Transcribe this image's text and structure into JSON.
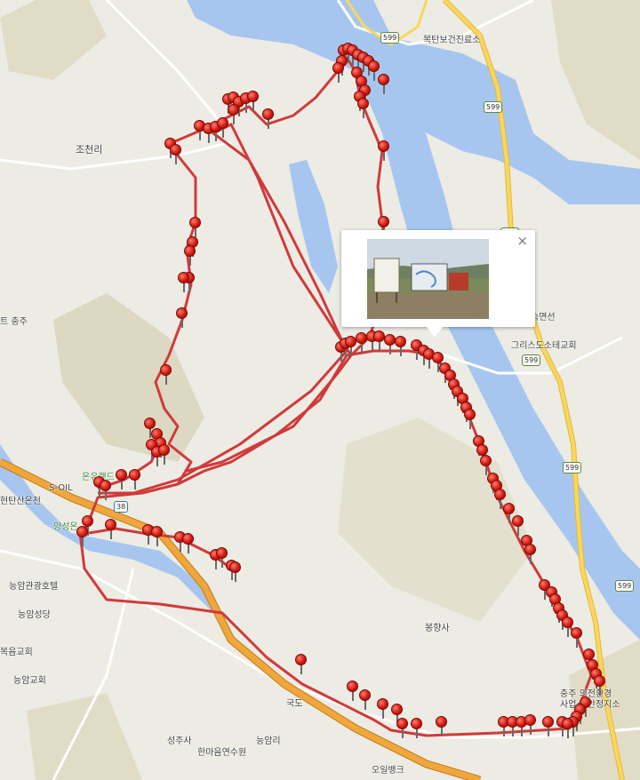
{
  "map": {
    "labels": {
      "bokta": "복탄보건진료소",
      "jocheon": "조천리",
      "chungju": "트 충주",
      "myeonsun": "숙면선",
      "church1": "그리스도소테교회",
      "oneumteu": "온유랜드",
      "soil": "S-OIL",
      "hantan": "현탄산온천",
      "yangseong": "양성온",
      "gwangho": "능암관광호텔",
      "neungam_cath": "능암성당",
      "bokeum": "복음교회",
      "neungam_church": "능암교회",
      "bonghyang": "봉향사",
      "seongjusa": "성주사",
      "hanmaeum": "한마음연수원",
      "neungamri": "능암리",
      "bank": "오일뱅크",
      "environ1": "충주 의전환경",
      "environ2": "사업소 안정지소",
      "expressway": "국도",
      "route599": "599",
      "route38": "38"
    },
    "icons": {
      "marker": "map-marker-icon",
      "close": "close-icon",
      "temple": "temple-icon",
      "gas": "gas-station-icon",
      "hotspring": "hotspring-icon"
    },
    "colors": {
      "route": "#d03a3a",
      "water": "#a7c6ef",
      "land": "#ecebe4",
      "forest": "#d9d6bf",
      "road": "#f6d35c",
      "expressway": "#e9a53a"
    }
  },
  "popup": {
    "close_label": "×",
    "photo_alt": "안내판 사진"
  }
}
